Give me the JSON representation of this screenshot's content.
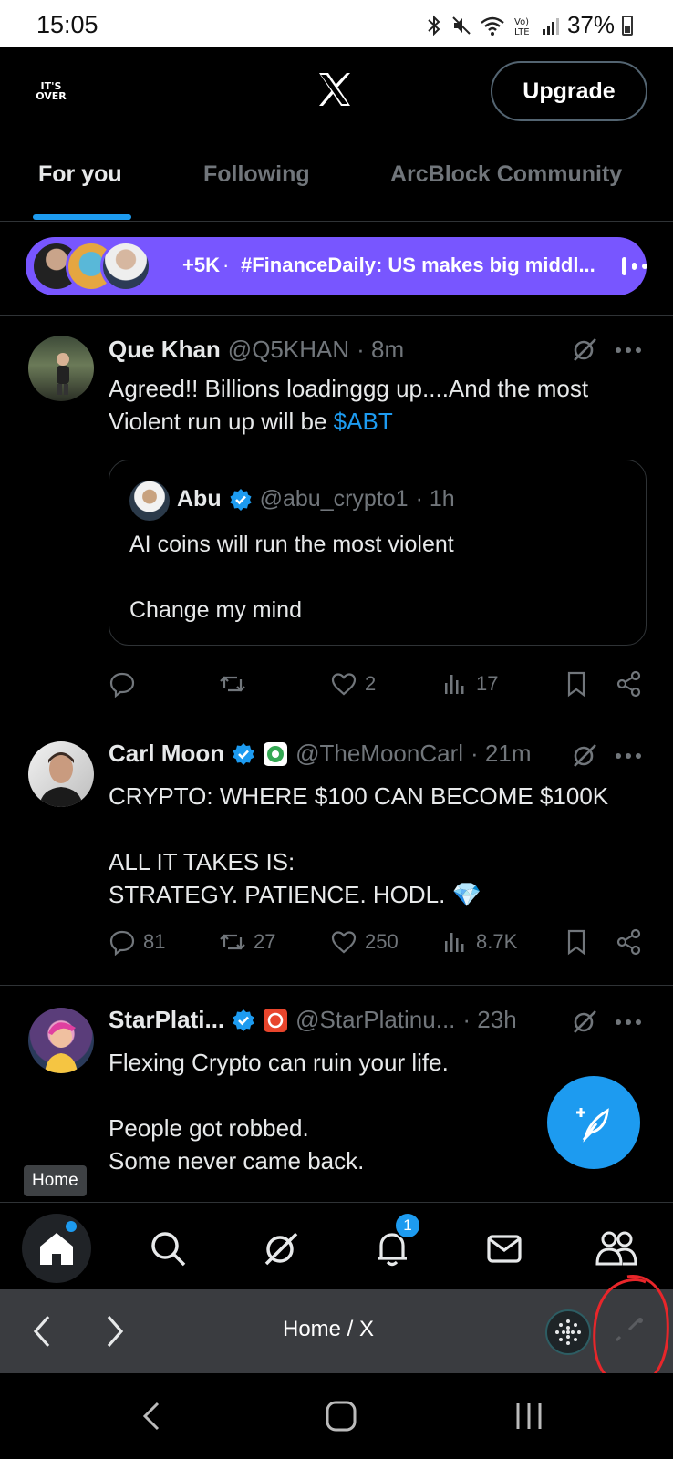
{
  "status_bar": {
    "time": "15:05",
    "battery": "37%"
  },
  "header": {
    "profile_logo_text": "IT'S OVER",
    "upgrade_label": "Upgrade"
  },
  "tabs": [
    {
      "label": "For you",
      "active": true
    },
    {
      "label": "Following",
      "active": false
    },
    {
      "label": "ArcBlock Community",
      "active": false
    }
  ],
  "spaces": {
    "listener_count": "+5K",
    "separator": "·",
    "title": "#FinanceDaily: US makes big middl..."
  },
  "posts": [
    {
      "name": "Que Khan",
      "handle": "@Q5KHAN",
      "time": "· 8m",
      "text_before": "Agreed!! Billions loadinggg up....And the most Violent run up will be ",
      "cashtag": "$ABT",
      "quote": {
        "name": "Abu",
        "handle": "@abu_crypto1",
        "time": "· 1h",
        "text": "AI coins will run the most violent\n\nChange my mind"
      },
      "replies": "",
      "reposts": "",
      "likes": "2",
      "views": "17"
    },
    {
      "name": "Carl Moon",
      "handle": "@TheMoonCarl",
      "time": "· 21m",
      "text": "CRYPTO: WHERE $100 CAN BECOME $100K\n\nALL IT TAKES IS:\nSTRATEGY. PATIENCE. HODL. 💎",
      "replies": "81",
      "reposts": "27",
      "likes": "250",
      "views": "8.7K"
    },
    {
      "name": "StarPlati...",
      "handle": "@StarPlatinu...",
      "time": "· 23h",
      "text": "Flexing Crypto can ruin your life.\n\nPeople got robbed.\nSome never came back."
    }
  ],
  "tooltip": "Home",
  "bottom_nav": {
    "items": [
      "home-icon",
      "search-icon",
      "grok-icon",
      "notifications-icon",
      "messages-icon",
      "communities-icon"
    ],
    "notification_count": "1"
  },
  "browser_bar": {
    "title": "Home / X"
  },
  "colors": {
    "accent": "#1d9bf0",
    "spaces": "#7856ff",
    "background": "#000000",
    "annotation": "#e8262a"
  }
}
